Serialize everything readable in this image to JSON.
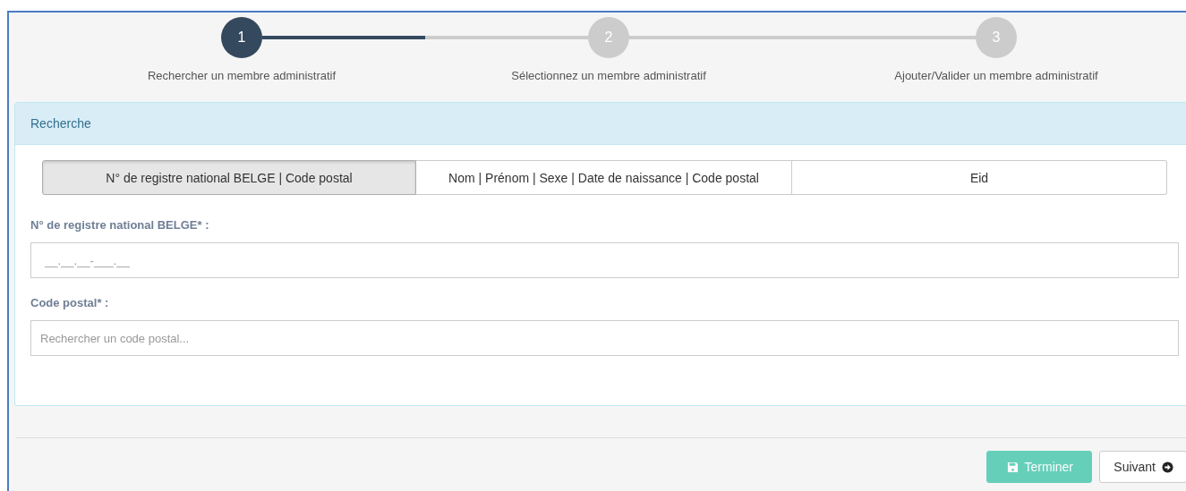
{
  "steps": [
    {
      "number": "1",
      "label": "Rechercher un membre administratif",
      "selected": true
    },
    {
      "number": "2",
      "label": "Sélectionnez un membre administratif",
      "selected": false
    },
    {
      "number": "3",
      "label": "Ajouter/Valider un membre administratif",
      "selected": false
    }
  ],
  "connectors": [
    {
      "level": 0.5
    }
  ],
  "panel": {
    "title": "Recherche",
    "tabs": [
      {
        "label": "N° de registre national BELGE | Code postal",
        "selected": true
      },
      {
        "label": "Nom | Prénom | Sexe | Date de naissance | Code postal",
        "selected": false
      },
      {
        "label": "Eid",
        "selected": false
      }
    ],
    "fields": [
      {
        "label": "N° de registre national BELGE* :",
        "placeholder": "__.__.__-___.__"
      },
      {
        "label": "Code postal* :",
        "placeholder": "Rechercher un code postal..."
      }
    ]
  },
  "buttons": [
    {
      "kind": "save",
      "label": "Terminer",
      "disabled": true
    },
    {
      "kind": "next",
      "label": "Suivant"
    }
  ]
}
